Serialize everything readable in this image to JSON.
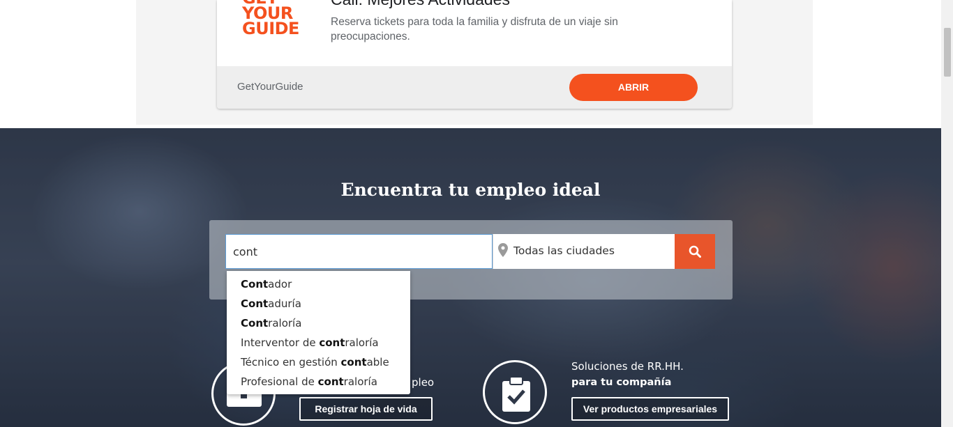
{
  "ad": {
    "logo_lines": [
      "GET",
      "YOUR",
      "GUIDE"
    ],
    "title": "Cali: Mejores Actividades",
    "description": "Reserva tickets para toda la familia y disfruta de un viaje sin preocupaciones.",
    "brand": "GetYourGuide",
    "open_label": "ABRIR",
    "accent_color": "#f4511e"
  },
  "hero": {
    "title": "Encuentra tu empleo ideal",
    "search": {
      "value": "cont",
      "city_placeholder": "Todas las ciudades",
      "button_icon": "search-icon",
      "city_icon": "map-pin-icon"
    },
    "suggestions": [
      {
        "bold": "Cont",
        "rest": "ador",
        "prefix": ""
      },
      {
        "bold": "Cont",
        "rest": "aduría",
        "prefix": ""
      },
      {
        "bold": "Cont",
        "rest": "raloría",
        "prefix": ""
      },
      {
        "prefix": "Interventor de ",
        "bold": "cont",
        "rest": "raloría"
      },
      {
        "prefix": "Técnico en gestión ",
        "bold": "cont",
        "rest": "able"
      },
      {
        "prefix": "Profesional de ",
        "bold": "cont",
        "rest": "raloría"
      }
    ],
    "left_text": "pleo",
    "cv_button": "Registrar hoja de vida",
    "right_text_line1": "Soluciones de RR.HH.",
    "right_text_line2": "para tu compañía",
    "products_button": "Ver productos empresariales"
  }
}
